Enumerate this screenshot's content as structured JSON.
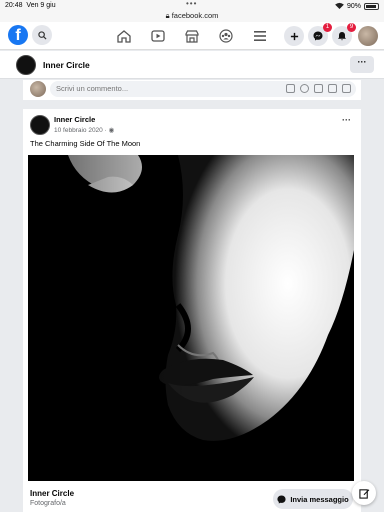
{
  "status": {
    "time": "20:48",
    "date": "Ven 9 giu",
    "url": "facebook.com",
    "battery": "90%",
    "dots": "•••"
  },
  "nav": {
    "logo": "f",
    "icons": [
      "search-icon",
      "home-icon",
      "watch-icon",
      "marketplace-icon",
      "groups-icon",
      "menu-icon",
      "plus-icon",
      "messenger-icon",
      "notifications-icon"
    ],
    "messenger_badge": "1",
    "notifications_badge": "9"
  },
  "page": {
    "title": "Inner Circle"
  },
  "comment": {
    "placeholder": "Scrivi un commento..."
  },
  "post": {
    "author": "Inner Circle",
    "date": "10 febbraio 2020",
    "caption": "The Charming Side Of The Moon",
    "footer_name": "Inner Circle",
    "footer_category": "Fotografo/a"
  },
  "actions": {
    "message": "Invia messaggio"
  },
  "colors": {
    "brand": "#1877f2",
    "badge": "#e41e3f"
  }
}
